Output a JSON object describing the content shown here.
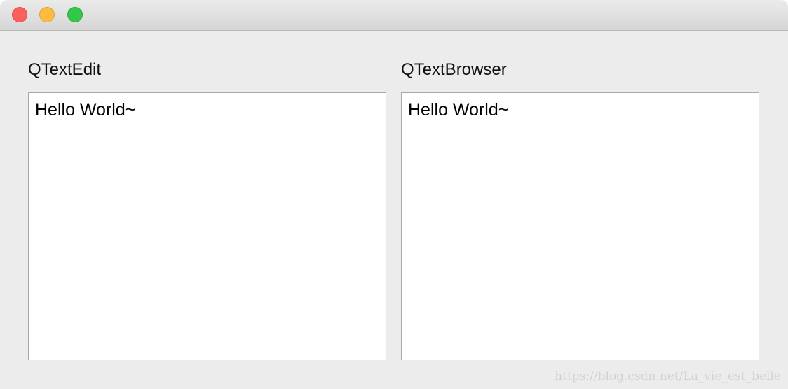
{
  "window": {
    "controls": {
      "close": "close-icon",
      "minimize": "minimize-icon",
      "maximize": "maximize-icon"
    }
  },
  "left_panel": {
    "label": "QTextEdit",
    "content": "Hello World~"
  },
  "right_panel": {
    "label": "QTextBrowser",
    "content": "Hello World~"
  },
  "watermark": "https://blog.csdn.net/La_vie_est_belle",
  "colors": {
    "window_bg": "#ececec",
    "close": "#fc605c",
    "minimize": "#fdbc40",
    "maximize": "#34c84a"
  }
}
